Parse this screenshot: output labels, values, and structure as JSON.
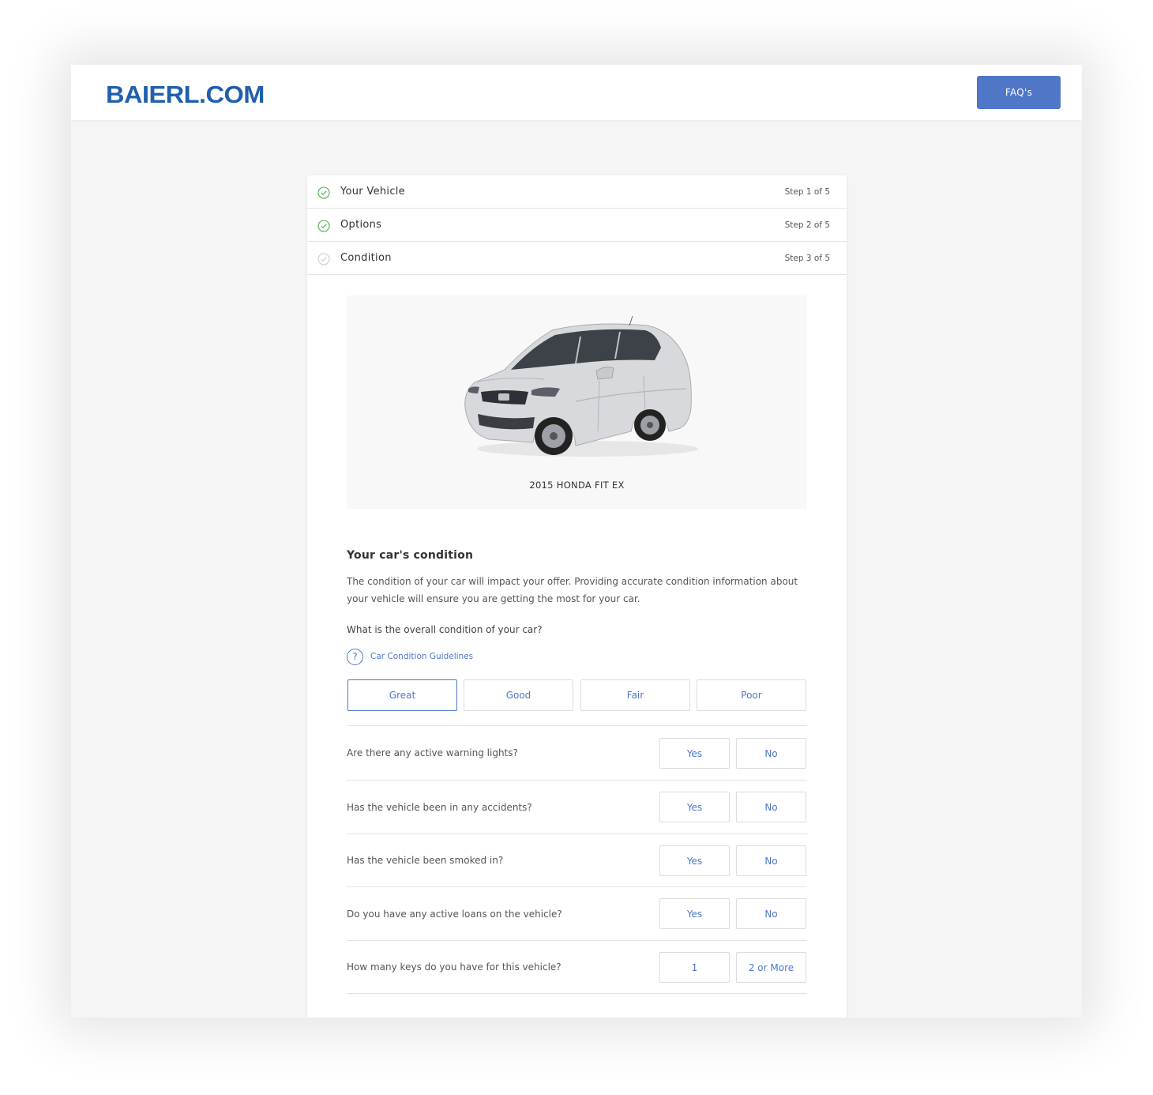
{
  "header": {
    "logo": "BAIERL.COM",
    "faq_label": "FAQ's"
  },
  "steps": [
    {
      "title": "Your Vehicle",
      "step": "Step 1 of 5",
      "complete": true
    },
    {
      "title": "Options",
      "step": "Step 2 of 5",
      "complete": true
    },
    {
      "title": "Condition",
      "step": "Step 3 of 5",
      "complete": false
    }
  ],
  "vehicle": {
    "name": "2015 HONDA FIT EX"
  },
  "condition": {
    "title": "Your car's condition",
    "description": "The condition of your car will impact your offer. Providing accurate condition information about your vehicle will ensure you are getting the most for your car.",
    "question": "What is the overall condition of your car?",
    "guideline_link": "Car Condition Guidelines",
    "options": [
      "Great",
      "Good",
      "Fair",
      "Poor"
    ],
    "selected": "Great"
  },
  "questions": [
    {
      "label": "Are there any active warning lights?",
      "options": [
        "Yes",
        "No"
      ]
    },
    {
      "label": "Has the vehicle been in any accidents?",
      "options": [
        "Yes",
        "No"
      ]
    },
    {
      "label": "Has the vehicle been smoked in?",
      "options": [
        "Yes",
        "No"
      ]
    },
    {
      "label": "Do you have any active loans on the vehicle?",
      "options": [
        "Yes",
        "No"
      ]
    },
    {
      "label": "How many keys do you have for this vehicle?",
      "options": [
        "1",
        "2 or More"
      ]
    }
  ],
  "colors": {
    "accent": "#4f76c7",
    "logo": "#1f5fae",
    "check_complete": "#4caf50",
    "check_pending": "#cccccc"
  },
  "icons": {
    "step_complete": "check-circle-icon",
    "step_pending": "check-circle-outline-icon",
    "help": "question-circle-icon"
  }
}
